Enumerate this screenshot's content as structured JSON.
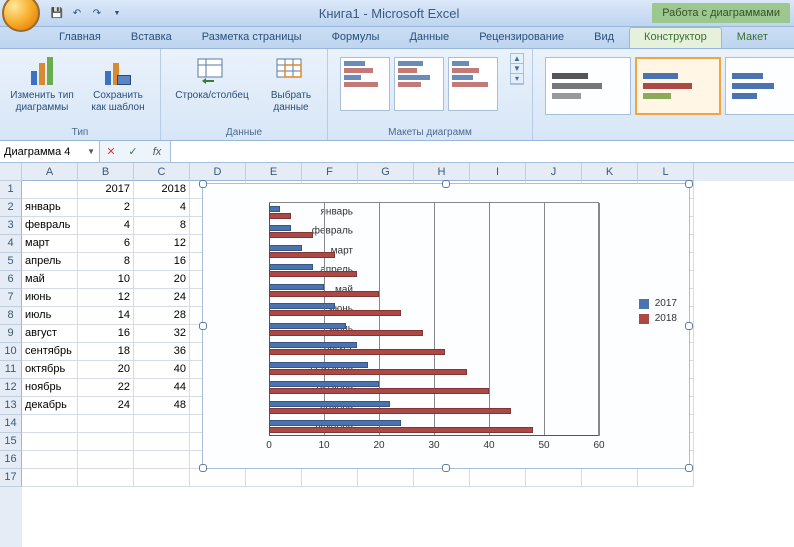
{
  "title": "Книга1 - Microsoft Excel",
  "chart_tools_label": "Работа с диаграммами",
  "tabs": {
    "home": "Главная",
    "insert": "Вставка",
    "layout": "Разметка страницы",
    "formulas": "Формулы",
    "data": "Данные",
    "review": "Рецензирование",
    "view": "Вид",
    "design": "Конструктор",
    "layout_ctx": "Макет"
  },
  "ribbon": {
    "change_type": "Изменить тип диаграммы",
    "save_template": "Сохранить как шаблон",
    "type_group": "Тип",
    "switch_rc": "Строка/столбец",
    "select_data": "Выбрать данные",
    "data_group": "Данные",
    "layouts_group": "Макеты диаграмм"
  },
  "name_box": "Диаграмма 4",
  "sheet": {
    "headers": [
      "A",
      "B",
      "C",
      "D",
      "E",
      "F",
      "G",
      "H",
      "I",
      "J",
      "K",
      "L"
    ],
    "rows": [
      {
        "a": "",
        "b": "2017",
        "c": "2018"
      },
      {
        "a": "январь",
        "b": "2",
        "c": "4"
      },
      {
        "a": "февраль",
        "b": "4",
        "c": "8"
      },
      {
        "a": "март",
        "b": "6",
        "c": "12"
      },
      {
        "a": "апрель",
        "b": "8",
        "c": "16"
      },
      {
        "a": "май",
        "b": "10",
        "c": "20"
      },
      {
        "a": "июнь",
        "b": "12",
        "c": "24"
      },
      {
        "a": "июль",
        "b": "14",
        "c": "28"
      },
      {
        "a": "август",
        "b": "16",
        "c": "32"
      },
      {
        "a": "сентябрь",
        "b": "18",
        "c": "36"
      },
      {
        "a": "октябрь",
        "b": "20",
        "c": "40"
      },
      {
        "a": "ноябрь",
        "b": "22",
        "c": "44"
      },
      {
        "a": "декабрь",
        "b": "24",
        "c": "48"
      }
    ]
  },
  "chart_data": {
    "type": "bar",
    "categories": [
      "январь",
      "февраль",
      "март",
      "апрель",
      "май",
      "июнь",
      "июль",
      "август",
      "сентябрь",
      "октябрь",
      "ноябрь",
      "декабрь"
    ],
    "series": [
      {
        "name": "2017",
        "color": "#4a73b0",
        "values": [
          2,
          4,
          6,
          8,
          10,
          12,
          14,
          16,
          18,
          20,
          22,
          24
        ]
      },
      {
        "name": "2018",
        "color": "#ac4946",
        "values": [
          4,
          8,
          12,
          16,
          20,
          24,
          28,
          32,
          36,
          40,
          44,
          48
        ]
      }
    ],
    "xlim": [
      0,
      60
    ],
    "xticks": [
      0,
      10,
      20,
      30,
      40,
      50,
      60
    ]
  },
  "legend": {
    "s1": "2017",
    "s2": "2018"
  },
  "colors": {
    "s1": "#4a73b0",
    "s2": "#ac4946"
  }
}
